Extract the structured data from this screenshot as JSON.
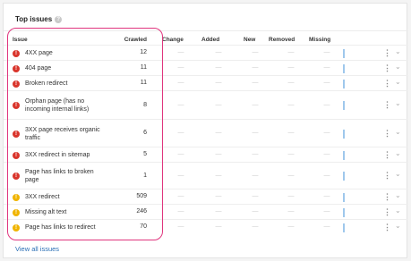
{
  "panel": {
    "title": "Top issues",
    "help_icon": "?"
  },
  "table": {
    "columns": {
      "issue": "Issue",
      "crawled": "Crawled",
      "change": "Change",
      "added": "Added",
      "new": "New",
      "removed": "Removed",
      "missing": "Missing"
    },
    "rows": [
      {
        "type": "error",
        "name": "4XX page",
        "crawled": "12"
      },
      {
        "type": "error",
        "name": "404 page",
        "crawled": "11"
      },
      {
        "type": "error",
        "name": "Broken redirect",
        "crawled": "11"
      },
      {
        "type": "error",
        "name": "Orphan page (has no incoming internal links)",
        "crawled": "8"
      },
      {
        "type": "error",
        "name": "3XX page receives organic traffic",
        "crawled": "6"
      },
      {
        "type": "error",
        "name": "3XX redirect in sitemap",
        "crawled": "5"
      },
      {
        "type": "error",
        "name": "Page has links to broken page",
        "crawled": "1"
      },
      {
        "type": "warning",
        "name": "3XX redirect",
        "crawled": "509"
      },
      {
        "type": "warning",
        "name": "Missing alt text",
        "crawled": "246"
      },
      {
        "type": "warning",
        "name": "Page has links to redirect",
        "crawled": "70"
      }
    ],
    "empty_value": "—",
    "row_menu_icon": "⋮",
    "row_expand_icon": "⌄"
  },
  "footer": {
    "view_all_label": "View all issues"
  },
  "colors": {
    "error": "#d9352c",
    "warning": "#f0b400",
    "highlight": "#e0367e",
    "link": "#2a6fb5",
    "spark": "#9fc8ec"
  }
}
